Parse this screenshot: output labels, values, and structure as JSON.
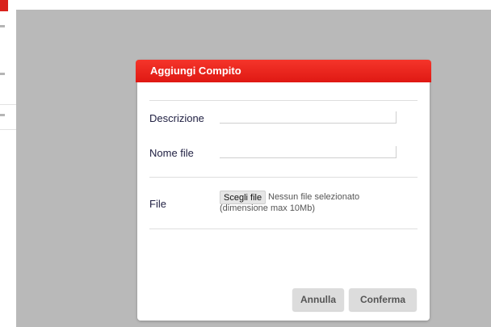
{
  "dialog": {
    "title": "Aggiungi Compito",
    "description_label": "Descrizione",
    "description_value": "",
    "filename_label": "Nome file",
    "filename_value": "",
    "file_label": "File",
    "choose_file_label": "Scegli file",
    "no_file_text": "Nessun file selezionato",
    "size_note": "(dimensione max 10Mb)",
    "cancel_label": "Annulla",
    "confirm_label": "Conferma"
  },
  "colors": {
    "header": "#e51f17",
    "overlay": "#b9b9b9",
    "label_text": "#222244"
  }
}
